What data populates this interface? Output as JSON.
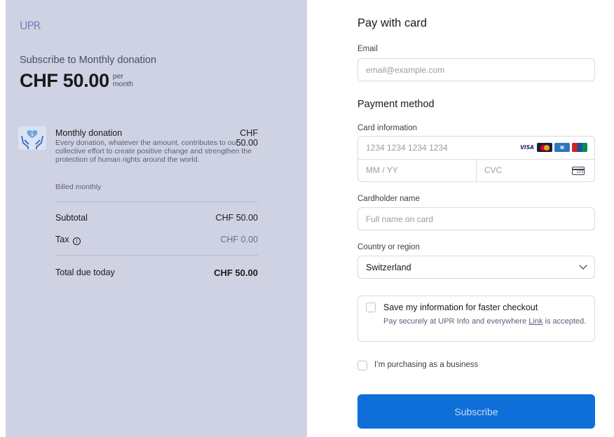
{
  "brand": {
    "logo_text": "UPR"
  },
  "summary": {
    "subscribe_title": "Subscribe to Monthly donation",
    "price": "CHF 50.00",
    "per": "per",
    "period": "month"
  },
  "line_item": {
    "name": "Monthly donation",
    "price": "CHF 50.00",
    "description": "Every donation, whatever the amount, contributes to our collective effort to create positive change and strengthen the protection of human rights around the world.",
    "billing": "Billed monthly",
    "icon": "hands-heart-icon"
  },
  "totals": {
    "subtotal_label": "Subtotal",
    "subtotal_value": "CHF 50.00",
    "tax_label": "Tax",
    "tax_icon": "info-circle-icon",
    "tax_value": "CHF 0.00",
    "total_label": "Total due today",
    "total_value": "CHF 50.00"
  },
  "form": {
    "title": "Pay with card",
    "email_label": "Email",
    "email_placeholder": "email@example.com",
    "payment_method_title": "Payment method",
    "card_info_label": "Card information",
    "card_number_placeholder": "1234 1234 1234 1234",
    "expiry_placeholder": "MM / YY",
    "cvc_placeholder": "CVC",
    "card_brands": [
      "VISA",
      "MC",
      "AMEX",
      "UP"
    ],
    "cardholder_label": "Cardholder name",
    "cardholder_placeholder": "Full name on card",
    "country_label": "Country or region",
    "country_value": "Switzerland",
    "save_title": "Save my information for faster checkout",
    "save_desc_prefix": "Pay securely at UPR Info and everywhere ",
    "save_desc_link": "Link",
    "save_desc_suffix": " is accepted.",
    "business_label": "I’m purchasing as a business",
    "subscribe_label": "Subscribe"
  },
  "colors": {
    "left_panel_bg": "#cfd2e3",
    "primary_button": "#0e6fd8"
  }
}
